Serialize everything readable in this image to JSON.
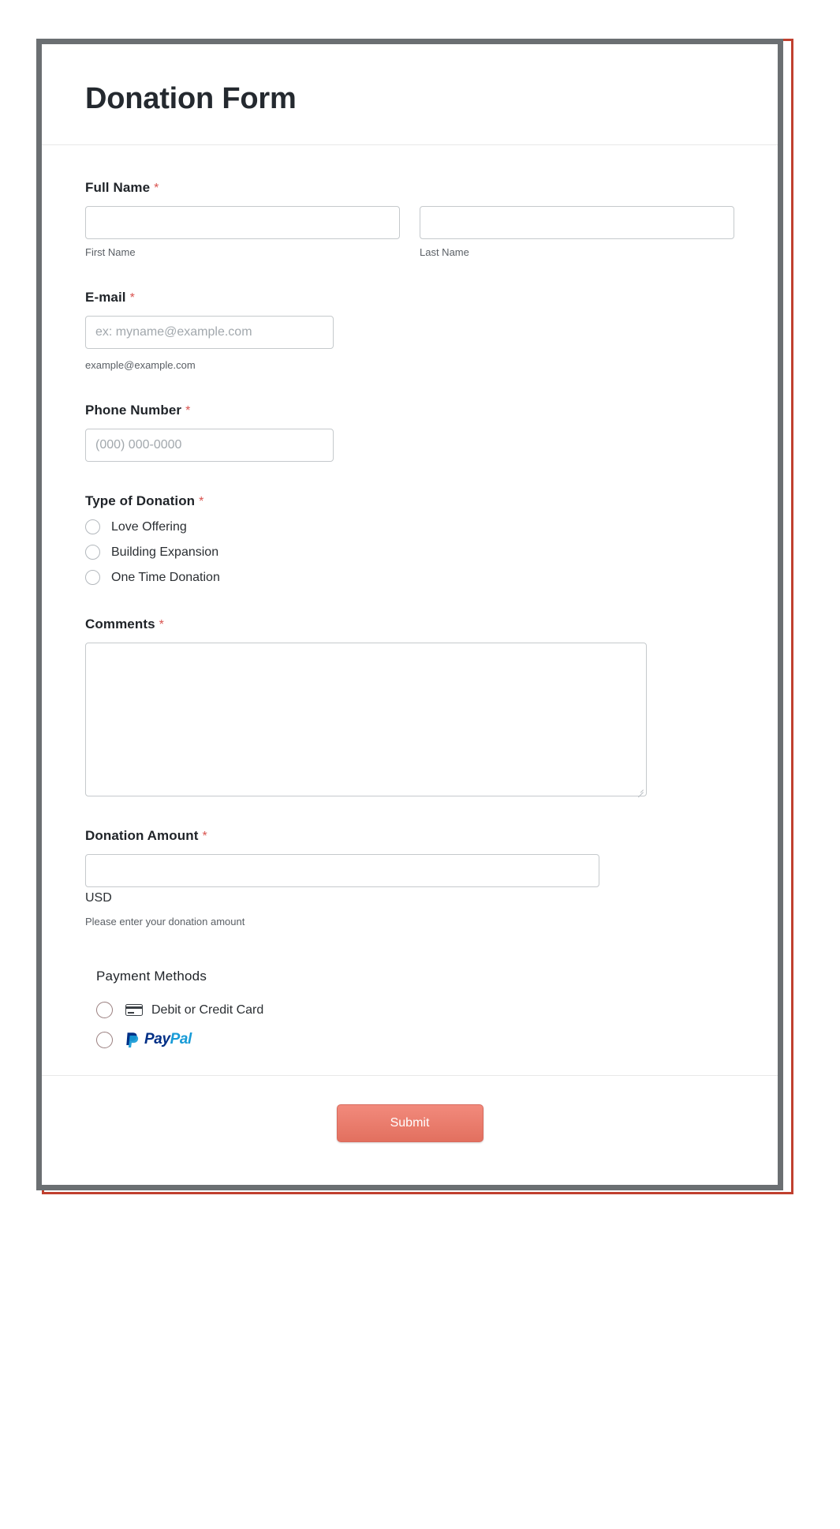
{
  "form": {
    "title": "Donation Form",
    "required_marker": "*",
    "fields": {
      "full_name": {
        "label": "Full Name",
        "first": {
          "value": "",
          "placeholder": "",
          "sublabel": "First Name"
        },
        "last": {
          "value": "",
          "placeholder": "",
          "sublabel": "Last Name"
        }
      },
      "email": {
        "label": "E-mail",
        "value": "",
        "placeholder": "ex: myname@example.com",
        "hint": "example@example.com"
      },
      "phone": {
        "label": "Phone Number",
        "value": "",
        "placeholder": "(000) 000-0000"
      },
      "donation_type": {
        "label": "Type of Donation",
        "options": [
          {
            "label": "Love Offering",
            "selected": false
          },
          {
            "label": "Building Expansion",
            "selected": false
          },
          {
            "label": "One Time Donation",
            "selected": false
          }
        ]
      },
      "comments": {
        "label": "Comments",
        "value": "",
        "placeholder": ""
      },
      "donation_amount": {
        "label": "Donation Amount",
        "value": "",
        "placeholder": "",
        "currency": "USD",
        "hint": "Please enter your donation amount"
      },
      "payment_methods": {
        "label": "Payment Methods",
        "options": [
          {
            "label": "Debit or Credit Card",
            "icon": "credit-card-icon",
            "selected": false
          },
          {
            "label": "PayPal",
            "icon": "paypal-logo",
            "selected": false
          }
        ],
        "paypal_wordmark": {
          "first": "Pay",
          "second": "Pal"
        }
      }
    },
    "submit_label": "Submit"
  },
  "colors": {
    "accent_frame": "#c0402f",
    "grey_frame": "#6b6f72",
    "required": "#d9534f",
    "submit_top": "#f28a7c",
    "submit_bottom": "#e2705f",
    "paypal_dark": "#002f86",
    "paypal_light": "#179bd7"
  }
}
